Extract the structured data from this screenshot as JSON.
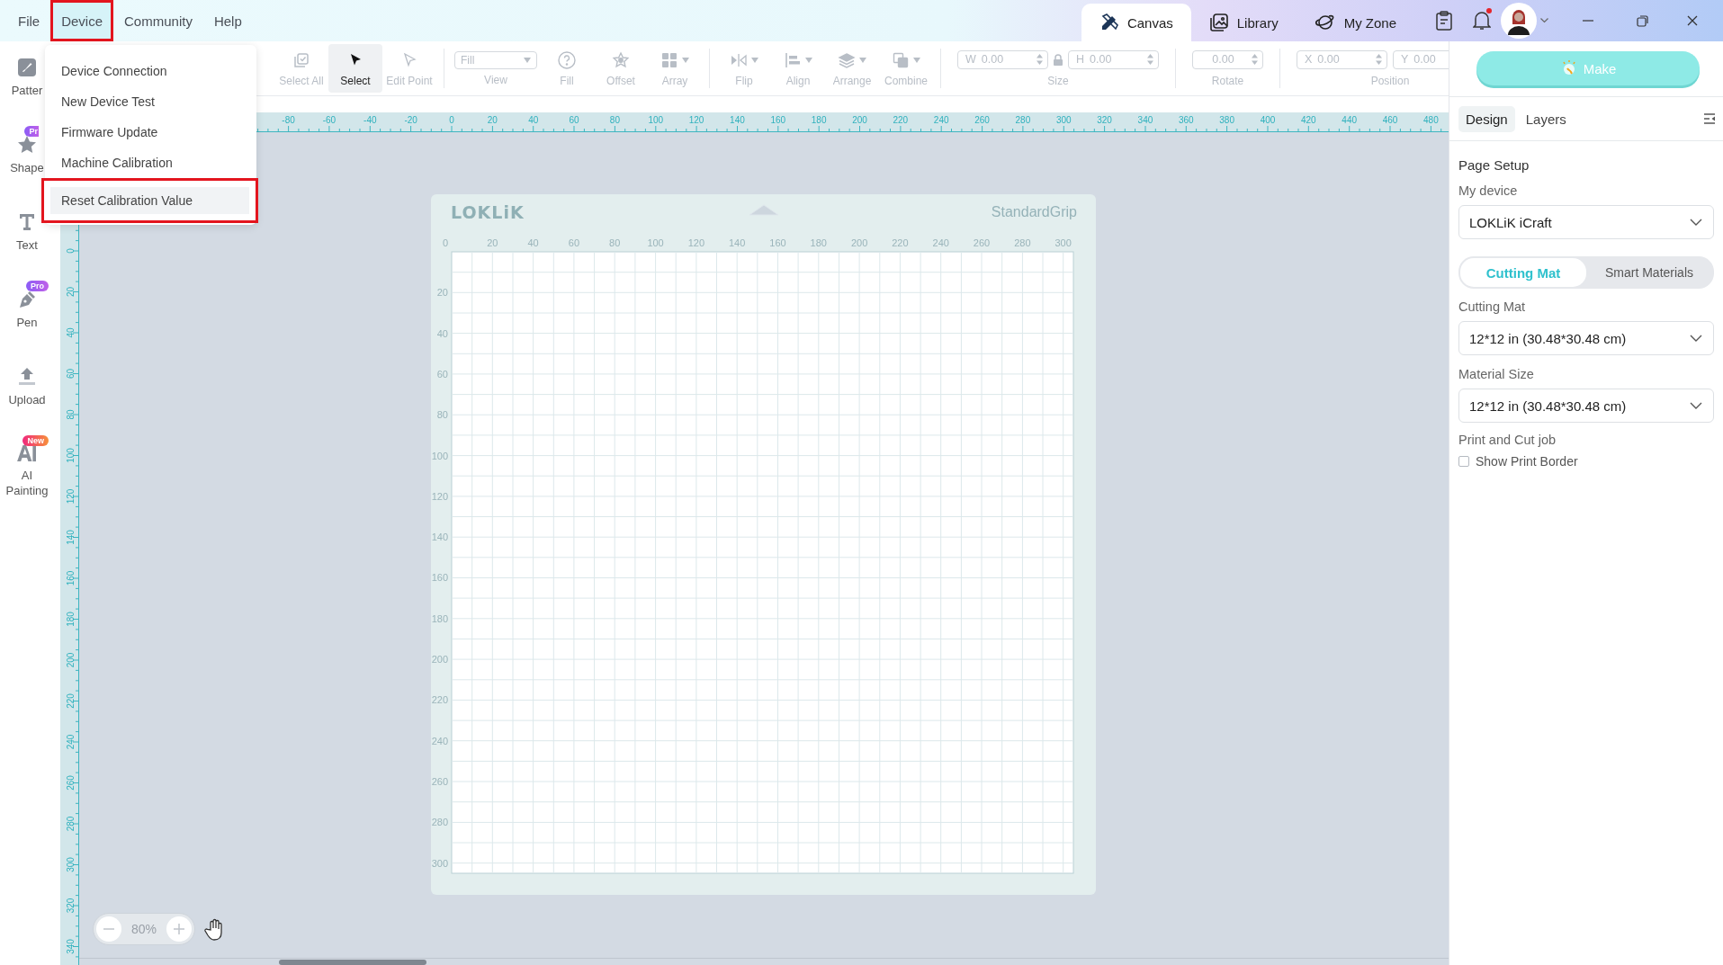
{
  "menu_bar": [
    {
      "label": "File",
      "open": false,
      "highlighted": false
    },
    {
      "label": "Device",
      "open": true,
      "highlighted": true
    },
    {
      "label": "Community",
      "open": false,
      "highlighted": false
    },
    {
      "label": "Help",
      "open": false,
      "highlighted": false
    }
  ],
  "device_menu": {
    "items": [
      {
        "label": "Device Connection",
        "hovered": false,
        "highlighted": false
      },
      {
        "label": "New Device Test",
        "hovered": false,
        "highlighted": false
      },
      {
        "label": "Firmware Update",
        "hovered": false,
        "highlighted": false
      },
      {
        "label": "Machine Calibration",
        "hovered": false,
        "highlighted": false
      },
      {
        "label": "Reset Calibration Value",
        "hovered": true,
        "highlighted": true
      }
    ]
  },
  "top_tabs": [
    {
      "label": "Canvas",
      "selected": true
    },
    {
      "label": "Library",
      "selected": false
    },
    {
      "label": "My Zone",
      "selected": false
    }
  ],
  "notifications": {
    "unread": true
  },
  "sidebar": [
    {
      "label": "Patter"
    },
    {
      "label": "Shape",
      "badge": {
        "text": "Pr",
        "kind": "pro"
      }
    },
    {
      "label": "Text"
    },
    {
      "label": "Pen",
      "badge": {
        "text": "Pro",
        "kind": "pro"
      }
    },
    {
      "label": "Upload"
    },
    {
      "label": "AI Painting",
      "badge": {
        "text": "New",
        "kind": "new"
      }
    }
  ],
  "toolbar": {
    "groups": [
      {
        "tools": [
          {
            "kind": "button",
            "label": "Select All",
            "selected": false,
            "disabled": true
          },
          {
            "kind": "button",
            "label": "Select",
            "selected": true,
            "disabled": false
          },
          {
            "kind": "button",
            "label": "Edit Point",
            "selected": false,
            "disabled": true
          }
        ]
      },
      {
        "tools": [
          {
            "kind": "dropdown",
            "label": "View",
            "value": "Fill",
            "selected": false,
            "disabled": true
          },
          {
            "kind": "button",
            "label": "Fill",
            "selected": false,
            "disabled": true
          },
          {
            "kind": "button",
            "label": "Offset",
            "selected": false,
            "disabled": true
          },
          {
            "kind": "menu_button",
            "label": "Array",
            "selected": false,
            "disabled": true
          }
        ]
      },
      {
        "tools": [
          {
            "kind": "menu_button",
            "label": "Flip",
            "selected": false,
            "disabled": true
          },
          {
            "kind": "menu_button",
            "label": "Align",
            "selected": false,
            "disabled": true
          },
          {
            "kind": "menu_button",
            "label": "Arrange",
            "selected": false,
            "disabled": true
          },
          {
            "kind": "menu_button",
            "label": "Combine",
            "selected": false,
            "disabled": true
          }
        ]
      },
      {
        "label": "Size",
        "locked": true,
        "disabled": true,
        "fields": [
          {
            "prefix": "W",
            "value": "0.00"
          },
          {
            "prefix": "H",
            "value": "0.00"
          }
        ]
      },
      {
        "label": "Rotate",
        "disabled": true,
        "fields": [
          {
            "value": "0.00"
          }
        ]
      },
      {
        "label": "Position",
        "disabled": true,
        "fields": [
          {
            "prefix": "X",
            "value": "0.00"
          },
          {
            "prefix": "Y",
            "value": "0.00"
          }
        ]
      }
    ]
  },
  "horizontal_ruler": {
    "labels": [
      "-80",
      "-60",
      "-40",
      "-20",
      "0",
      "20",
      "40",
      "60",
      "80",
      "100",
      "120",
      "140",
      "160",
      "180",
      "200",
      "220",
      "240",
      "260",
      "280",
      "300",
      "320",
      "340",
      "360",
      "380",
      "400",
      "420",
      "440",
      "460",
      "480"
    ]
  },
  "vertical_ruler": {
    "labels": [
      "0",
      "20",
      "40",
      "60",
      "80",
      "100",
      "120",
      "140",
      "160",
      "180",
      "200",
      "220",
      "240",
      "260",
      "280",
      "300",
      "320",
      "340"
    ]
  },
  "mat": {
    "brand": "LOKLiK",
    "grip": "StandardGrip",
    "x_labels": [
      "0",
      "20",
      "40",
      "60",
      "80",
      "100",
      "120",
      "140",
      "160",
      "180",
      "200",
      "220",
      "240",
      "260",
      "280",
      "300"
    ],
    "y_labels": [
      "20",
      "40",
      "60",
      "80",
      "100",
      "120",
      "140",
      "160",
      "180",
      "200",
      "220",
      "240",
      "260",
      "280",
      "300"
    ]
  },
  "zoom": {
    "value": "80%"
  },
  "right_panel": {
    "make_button": "Make",
    "tabs": [
      {
        "label": "Design",
        "selected": true
      },
      {
        "label": "Layers",
        "selected": false
      }
    ],
    "title": "Page Setup",
    "device": {
      "label": "My device",
      "value": "LOKLiK iCraft"
    },
    "mode_toggle": [
      {
        "label": "Cutting Mat",
        "selected": true
      },
      {
        "label": "Smart Materials",
        "selected": false
      }
    ],
    "selects": [
      {
        "label": "Cutting Mat",
        "value": "12*12 in (30.48*30.48 cm)"
      },
      {
        "label": "Material Size",
        "value": "12*12 in (30.48*30.48 cm)"
      }
    ],
    "print_and_cut": {
      "title": "Print and Cut job",
      "checkbox": {
        "label": "Show Print Border",
        "checked": false
      }
    }
  }
}
